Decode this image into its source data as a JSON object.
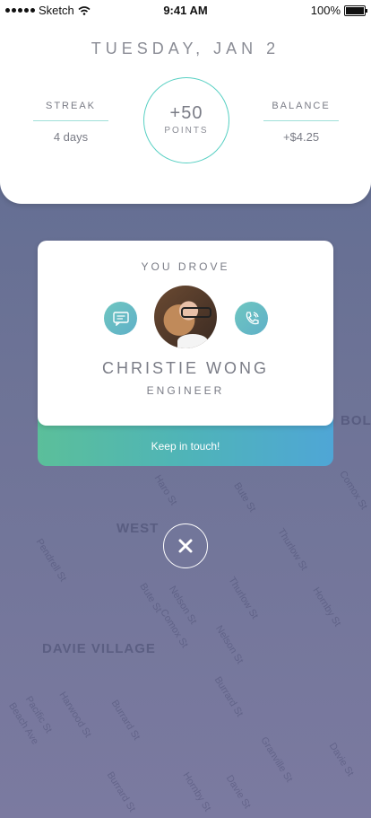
{
  "status_bar": {
    "carrier": "Sketch",
    "time": "9:41 AM",
    "battery": "100%",
    "battery_level": 1.0
  },
  "header": {
    "date": "TUESDAY, JAN 2",
    "streak": {
      "title": "STREAK",
      "value": "4 days"
    },
    "points": {
      "value": "+50",
      "label": "POINTS"
    },
    "balance": {
      "title": "BALANCE",
      "value": "+$4.25"
    }
  },
  "driver_card": {
    "title": "YOU DROVE",
    "name": "CHRISTIE WONG",
    "role": "ENGINEER",
    "keep_in_touch": "Keep in touch!"
  },
  "map": {
    "districts": [
      "WEST",
      "DAVIE VILLAGE",
      "BOL"
    ],
    "streets": [
      "Haro St",
      "Bute St",
      "Thurlow St",
      "Nelson St",
      "Bute St",
      "Comox St",
      "Thurlow St",
      "Nelson St",
      "Burrard St",
      "Harwood St",
      "Hornby St",
      "Burrard St",
      "Pendrell St",
      "Pacific St",
      "Beach Ave",
      "Granville St",
      "Davie St",
      "Hornby St",
      "Burrard St",
      "Comox St",
      "Davie St"
    ]
  },
  "icons": {
    "message": "message-icon",
    "phone": "phone-icon",
    "close": "close-icon"
  },
  "colors": {
    "accent_teal": "#58d0c3",
    "gradient_start": "#5bbf9a",
    "gradient_end": "#4fa6d6"
  }
}
